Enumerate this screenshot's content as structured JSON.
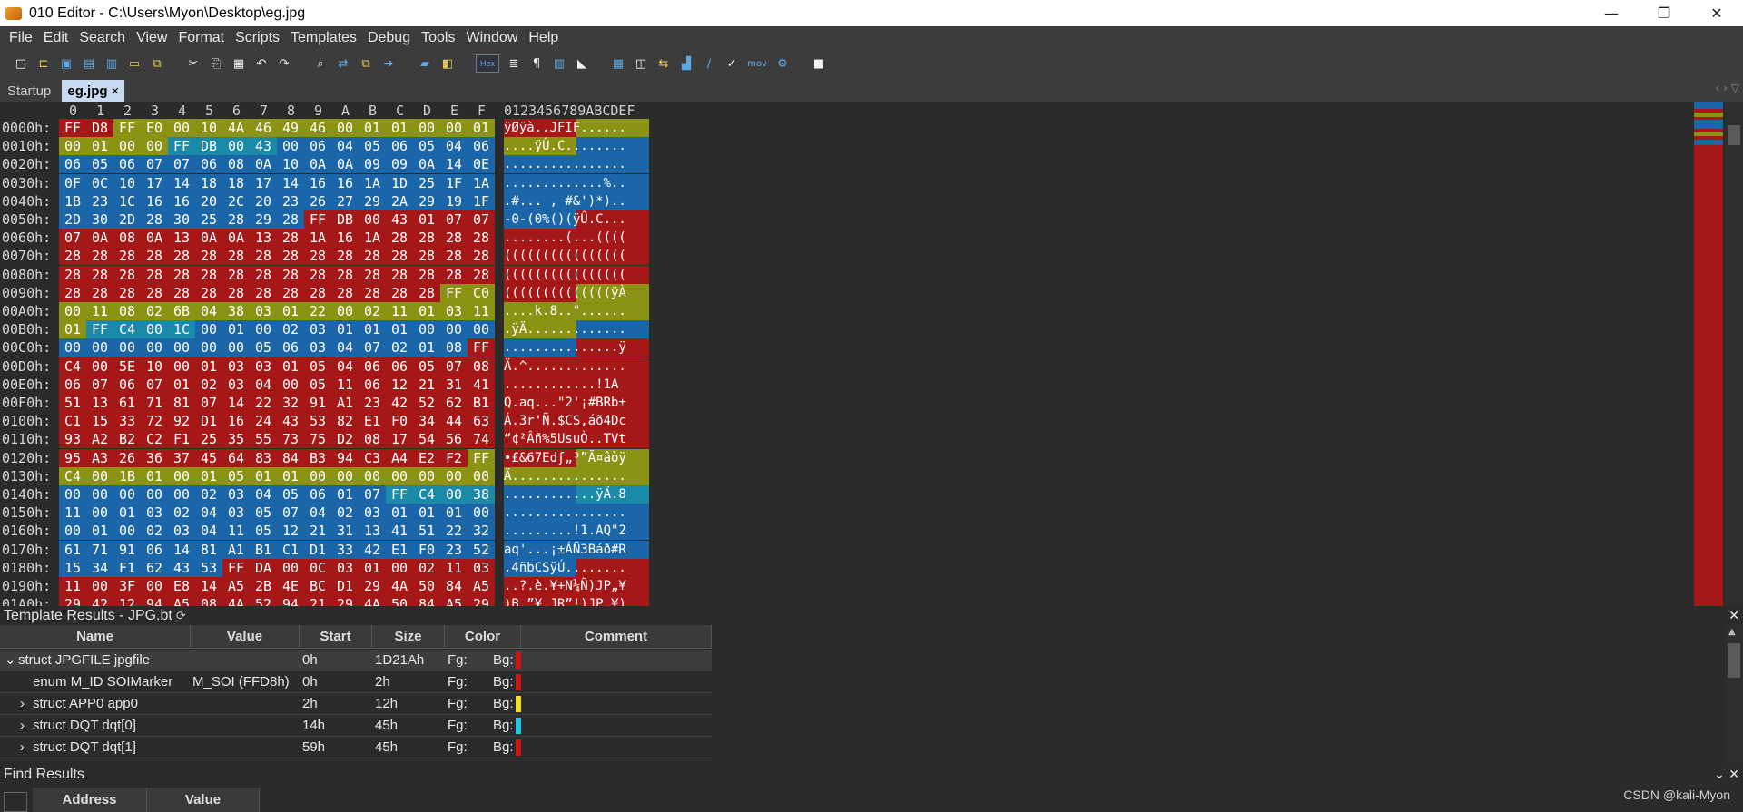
{
  "window": {
    "title": "010 Editor - C:\\Users\\Myon\\Desktop\\eg.jpg",
    "minimize": "—",
    "restore": "❐",
    "close": "✕"
  },
  "menu": [
    "File",
    "Edit",
    "Search",
    "View",
    "Format",
    "Scripts",
    "Templates",
    "Debug",
    "Tools",
    "Window",
    "Help"
  ],
  "toolbar": {
    "hex_label": "Hex",
    "mov_label": "mov",
    "icons": [
      "new-file-icon",
      "open-file-icon",
      "save-icon",
      "save-as-icon",
      "save-all-icon",
      "open-folder-icon",
      "open-recent-icon",
      "cut-icon",
      "copy-icon",
      "paste-icon",
      "undo-icon",
      "redo-icon",
      "find-icon",
      "find-replace-icon",
      "find-in-files-icon",
      "goto-icon",
      "bookmark-icon",
      "compare-icon",
      "hex-mode",
      "text-mode-icon",
      "pilcrow-icon",
      "columns-icon",
      "highlight-icon",
      "calculator-icon",
      "inspector-icon",
      "swap-icon",
      "histogram-icon",
      "checksum-icon",
      "script-icon",
      "mov-icon",
      "process-icon",
      "stop-icon"
    ]
  },
  "tabs": [
    {
      "label": "Startup",
      "active": false
    },
    {
      "label": "eg.jpg",
      "active": true,
      "close": "×"
    }
  ],
  "hex": {
    "col_headers": [
      "0",
      "1",
      "2",
      "3",
      "4",
      "5",
      "6",
      "7",
      "8",
      "9",
      "A",
      "B",
      "C",
      "D",
      "E",
      "F"
    ],
    "ascii_header": "0123456789ABCDEF",
    "colors": {
      "red": "#a61818",
      "blue": "#1b66a8",
      "olive": "#8c9214",
      "teal": "#1b8aa8"
    },
    "rows": [
      {
        "addr": "0000h:",
        "bytes": [
          "FF",
          "D8",
          "FF",
          "E0",
          "00",
          "10",
          "4A",
          "46",
          "49",
          "46",
          "00",
          "01",
          "01",
          "00",
          "00",
          "01"
        ],
        "ascii": "ÿØÿà..JFIF......",
        "colors": "rrooooooooooooooo"
      },
      {
        "addr": "0010h:",
        "bytes": [
          "00",
          "01",
          "00",
          "00",
          "FF",
          "DB",
          "00",
          "43",
          "00",
          "06",
          "04",
          "05",
          "06",
          "05",
          "04",
          "06"
        ],
        "ascii": "....ÿÛ.C........",
        "colors": "oooottttbbbbbbbb"
      },
      {
        "addr": "0020h:",
        "bytes": [
          "06",
          "05",
          "06",
          "07",
          "07",
          "06",
          "08",
          "0A",
          "10",
          "0A",
          "0A",
          "09",
          "09",
          "0A",
          "14",
          "0E"
        ],
        "ascii": "................",
        "colors": "bbbbbbbbbbbbbbbb"
      },
      {
        "addr": "0030h:",
        "bytes": [
          "0F",
          "0C",
          "10",
          "17",
          "14",
          "18",
          "18",
          "17",
          "14",
          "16",
          "16",
          "1A",
          "1D",
          "25",
          "1F",
          "1A"
        ],
        "ascii": ".............%..",
        "colors": "bbbbbbbbbbbbbbbb"
      },
      {
        "addr": "0040h:",
        "bytes": [
          "1B",
          "23",
          "1C",
          "16",
          "16",
          "20",
          "2C",
          "20",
          "23",
          "26",
          "27",
          "29",
          "2A",
          "29",
          "19",
          "1F"
        ],
        "ascii": ".#... , #&')*)..",
        "colors": "bbbbbbbbbbbbbbbb"
      },
      {
        "addr": "0050h:",
        "bytes": [
          "2D",
          "30",
          "2D",
          "28",
          "30",
          "25",
          "28",
          "29",
          "28",
          "FF",
          "DB",
          "00",
          "43",
          "01",
          "07",
          "07"
        ],
        "ascii": "-0-(0%()(ÿÛ.C...",
        "colors": "bbbbbbbbbrrrrrrr"
      },
      {
        "addr": "0060h:",
        "bytes": [
          "07",
          "0A",
          "08",
          "0A",
          "13",
          "0A",
          "0A",
          "13",
          "28",
          "1A",
          "16",
          "1A",
          "28",
          "28",
          "28",
          "28"
        ],
        "ascii": "........(...((((",
        "colors": "rrrrrrrrrrrrrrrr"
      },
      {
        "addr": "0070h:",
        "bytes": [
          "28",
          "28",
          "28",
          "28",
          "28",
          "28",
          "28",
          "28",
          "28",
          "28",
          "28",
          "28",
          "28",
          "28",
          "28",
          "28"
        ],
        "ascii": "((((((((((((((((",
        "colors": "rrrrrrrrrrrrrrrr"
      },
      {
        "addr": "0080h:",
        "bytes": [
          "28",
          "28",
          "28",
          "28",
          "28",
          "28",
          "28",
          "28",
          "28",
          "28",
          "28",
          "28",
          "28",
          "28",
          "28",
          "28"
        ],
        "ascii": "((((((((((((((((",
        "colors": "rrrrrrrrrrrrrrrr"
      },
      {
        "addr": "0090h:",
        "bytes": [
          "28",
          "28",
          "28",
          "28",
          "28",
          "28",
          "28",
          "28",
          "28",
          "28",
          "28",
          "28",
          "28",
          "28",
          "FF",
          "C0"
        ],
        "ascii": "((((((((((((((ÿÀ",
        "colors": "rrrrrrrrrrrrrroo"
      },
      {
        "addr": "00A0h:",
        "bytes": [
          "00",
          "11",
          "08",
          "02",
          "6B",
          "04",
          "38",
          "03",
          "01",
          "22",
          "00",
          "02",
          "11",
          "01",
          "03",
          "11"
        ],
        "ascii": "....k.8..\"......",
        "colors": "oooooooooooooooo"
      },
      {
        "addr": "00B0h:",
        "bytes": [
          "01",
          "FF",
          "C4",
          "00",
          "1C",
          "00",
          "01",
          "00",
          "02",
          "03",
          "01",
          "01",
          "01",
          "00",
          "00",
          "00"
        ],
        "ascii": ".ÿÄ.............",
        "colors": "ottttbbbbbbbbbbb"
      },
      {
        "addr": "00C0h:",
        "bytes": [
          "00",
          "00",
          "00",
          "00",
          "00",
          "00",
          "00",
          "05",
          "06",
          "03",
          "04",
          "07",
          "02",
          "01",
          "08",
          "FF"
        ],
        "ascii": "...............ÿ",
        "colors": "bbbbbbbbbbbbbbbr"
      },
      {
        "addr": "00D0h:",
        "bytes": [
          "C4",
          "00",
          "5E",
          "10",
          "00",
          "01",
          "03",
          "03",
          "01",
          "05",
          "04",
          "06",
          "06",
          "05",
          "07",
          "08"
        ],
        "ascii": "Ä.^.............",
        "colors": "rrrrrrrrrrrrrrrr"
      },
      {
        "addr": "00E0h:",
        "bytes": [
          "06",
          "07",
          "06",
          "07",
          "01",
          "02",
          "03",
          "04",
          "00",
          "05",
          "11",
          "06",
          "12",
          "21",
          "31",
          "41"
        ],
        "ascii": "............!1A",
        "colors": "rrrrrrrrrrrrrrrr"
      },
      {
        "addr": "00F0h:",
        "bytes": [
          "51",
          "13",
          "61",
          "71",
          "81",
          "07",
          "14",
          "22",
          "32",
          "91",
          "A1",
          "23",
          "42",
          "52",
          "62",
          "B1"
        ],
        "ascii": "Q.aq...\"2'¡#BRb±",
        "colors": "rrrrrrrrrrrrrrrr"
      },
      {
        "addr": "0100h:",
        "bytes": [
          "C1",
          "15",
          "33",
          "72",
          "92",
          "D1",
          "16",
          "24",
          "43",
          "53",
          "82",
          "E1",
          "F0",
          "34",
          "44",
          "63"
        ],
        "ascii": "Á.3r'Ñ.$CS‚áð4Dc",
        "colors": "rrrrrrrrrrrrrrrr"
      },
      {
        "addr": "0110h:",
        "bytes": [
          "93",
          "A2",
          "B2",
          "C2",
          "F1",
          "25",
          "35",
          "55",
          "73",
          "75",
          "D2",
          "08",
          "17",
          "54",
          "56",
          "74"
        ],
        "ascii": "“¢²Âñ%5UsuÒ..TVt",
        "colors": "rrrrrrrrrrrrrrrr"
      },
      {
        "addr": "0120h:",
        "bytes": [
          "95",
          "A3",
          "26",
          "36",
          "37",
          "45",
          "64",
          "83",
          "84",
          "B3",
          "94",
          "C3",
          "A4",
          "E2",
          "F2",
          "FF"
        ],
        "ascii": "•£&67Edƒ„³”Ã¤âòÿ",
        "colors": "rrrrrrrrrrrrrrro"
      },
      {
        "addr": "0130h:",
        "bytes": [
          "C4",
          "00",
          "1B",
          "01",
          "00",
          "01",
          "05",
          "01",
          "01",
          "00",
          "00",
          "00",
          "00",
          "00",
          "00",
          "00"
        ],
        "ascii": "Ä...............",
        "colors": "oooooooooooooooo"
      },
      {
        "addr": "0140h:",
        "bytes": [
          "00",
          "00",
          "00",
          "00",
          "00",
          "02",
          "03",
          "04",
          "05",
          "06",
          "01",
          "07",
          "FF",
          "C4",
          "00",
          "38"
        ],
        "ascii": "............ÿÄ.8",
        "colors": "bbbbbbbbbbbbtttt"
      },
      {
        "addr": "0150h:",
        "bytes": [
          "11",
          "00",
          "01",
          "03",
          "02",
          "04",
          "03",
          "05",
          "07",
          "04",
          "02",
          "03",
          "01",
          "01",
          "01",
          "00"
        ],
        "ascii": "................",
        "colors": "bbbbbbbbbbbbbbbb"
      },
      {
        "addr": "0160h:",
        "bytes": [
          "00",
          "01",
          "00",
          "02",
          "03",
          "04",
          "11",
          "05",
          "12",
          "21",
          "31",
          "13",
          "41",
          "51",
          "22",
          "32"
        ],
        "ascii": ".........!1.AQ\"2",
        "colors": "bbbbbbbbbbbbbbbb"
      },
      {
        "addr": "0170h:",
        "bytes": [
          "61",
          "71",
          "91",
          "06",
          "14",
          "81",
          "A1",
          "B1",
          "C1",
          "D1",
          "33",
          "42",
          "E1",
          "F0",
          "23",
          "52"
        ],
        "ascii": "aq'...¡±ÁÑ3Báð#R",
        "colors": "bbbbbbbbbbbbbbbb"
      },
      {
        "addr": "0180h:",
        "bytes": [
          "15",
          "34",
          "F1",
          "62",
          "43",
          "53",
          "FF",
          "DA",
          "00",
          "0C",
          "03",
          "01",
          "00",
          "02",
          "11",
          "03"
        ],
        "ascii": ".4ñbCSÿÚ........",
        "colors": "bbbbbbrrrrrrrrrr"
      },
      {
        "addr": "0190h:",
        "bytes": [
          "11",
          "00",
          "3F",
          "00",
          "E8",
          "14",
          "A5",
          "2B",
          "4E",
          "BC",
          "D1",
          "29",
          "4A",
          "50",
          "84",
          "A5"
        ],
        "ascii": "..?.è.¥+N¼Ñ)JP„¥",
        "colors": "rrrrrrrrrrrrrrrr"
      },
      {
        "addr": "01A0h:",
        "bytes": [
          "29",
          "42",
          "12",
          "94",
          "A5",
          "08",
          "4A",
          "52",
          "94",
          "21",
          "29",
          "4A",
          "50",
          "84",
          "A5",
          "29"
        ],
        "ascii": ")B.”¥.JR”!)JP„¥)",
        "colors": "rrrrrrrrrrrrrrrr"
      }
    ]
  },
  "template_results": {
    "title": "Template Results - JPG.bt",
    "refresh_icon": "⟳",
    "columns": [
      "Name",
      "Value",
      "Start",
      "Size",
      "Color",
      "Comment"
    ],
    "rows": [
      {
        "expander": "⌄",
        "name": "struct JPGFILE jpgfile",
        "value": "",
        "start": "0h",
        "size": "1D21Ah",
        "fg": "Fg:",
        "bg": "Bg:",
        "bg_color": "#c81818",
        "indent": 0
      },
      {
        "expander": "",
        "name": "enum M_ID SOIMarker",
        "value": "M_SOI (FFD8h)",
        "start": "0h",
        "size": "2h",
        "fg": "Fg:",
        "bg": "Bg:",
        "bg_color": "#c81818",
        "indent": 1
      },
      {
        "expander": "›",
        "name": "struct APP0 app0",
        "value": "",
        "start": "2h",
        "size": "12h",
        "fg": "Fg:",
        "bg": "Bg:",
        "bg_color": "#f0e020",
        "indent": 1
      },
      {
        "expander": "›",
        "name": "struct DQT dqt[0]",
        "value": "",
        "start": "14h",
        "size": "45h",
        "fg": "Fg:",
        "bg": "Bg:",
        "bg_color": "#20c8e8",
        "indent": 1
      },
      {
        "expander": "›",
        "name": "struct DQT dqt[1]",
        "value": "",
        "start": "59h",
        "size": "45h",
        "fg": "Fg:",
        "bg": "Bg:",
        "bg_color": "#c81818",
        "indent": 1
      }
    ]
  },
  "find_results": {
    "title": "Find Results",
    "columns": [
      "Address",
      "Value"
    ]
  },
  "watermark": "CSDN @kali-Myon"
}
